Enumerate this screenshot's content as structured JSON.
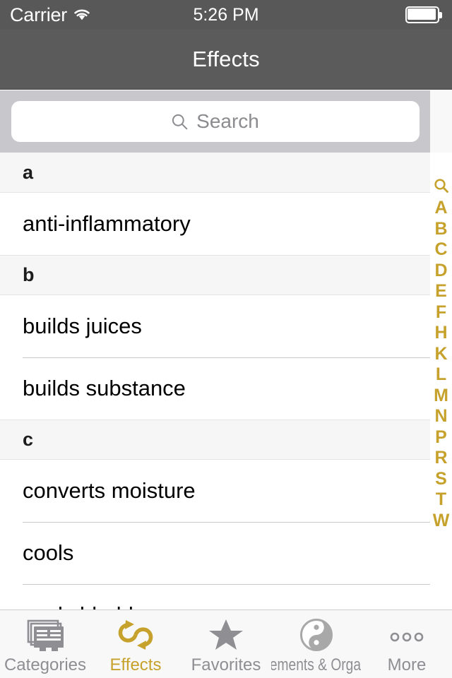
{
  "status_bar": {
    "carrier": "Carrier",
    "wifi_icon": "wifi-icon",
    "time": "5:26 PM",
    "battery_icon": "battery-full-icon"
  },
  "nav_bar": {
    "title": "Effects"
  },
  "search": {
    "placeholder": "Search",
    "value": "",
    "icon": "search-icon"
  },
  "list": {
    "sections": [
      {
        "header": "a",
        "items": [
          "anti-inflammatory"
        ]
      },
      {
        "header": "b",
        "items": [
          "builds juices",
          "builds substance"
        ]
      },
      {
        "header": "c",
        "items": [
          "converts moisture",
          "cools",
          "cools bladder"
        ]
      }
    ]
  },
  "index_bar": {
    "search_icon": "search-icon",
    "letters": [
      "A",
      "B",
      "C",
      "D",
      "E",
      "F",
      "H",
      "K",
      "L",
      "M",
      "N",
      "P",
      "R",
      "S",
      "T",
      "W"
    ]
  },
  "tab_bar": {
    "tabs": [
      {
        "label": "Categories",
        "icon": "stacked-cards-icon",
        "active": false
      },
      {
        "label": "Effects",
        "icon": "cycle-arrows-icon",
        "active": true
      },
      {
        "label": "Favorites",
        "icon": "star-icon",
        "active": false
      },
      {
        "label": "Elements & Organs",
        "icon": "yin-yang-icon",
        "active": false
      },
      {
        "label": "More",
        "icon": "three-dots-icon",
        "active": false
      }
    ]
  },
  "colors": {
    "accent": "#c6a22c",
    "nav_background": "#5b5b5b",
    "search_background": "#c8c7cc",
    "tab_inactive": "#8e8e93",
    "section_header_background": "#f6f6f6"
  }
}
